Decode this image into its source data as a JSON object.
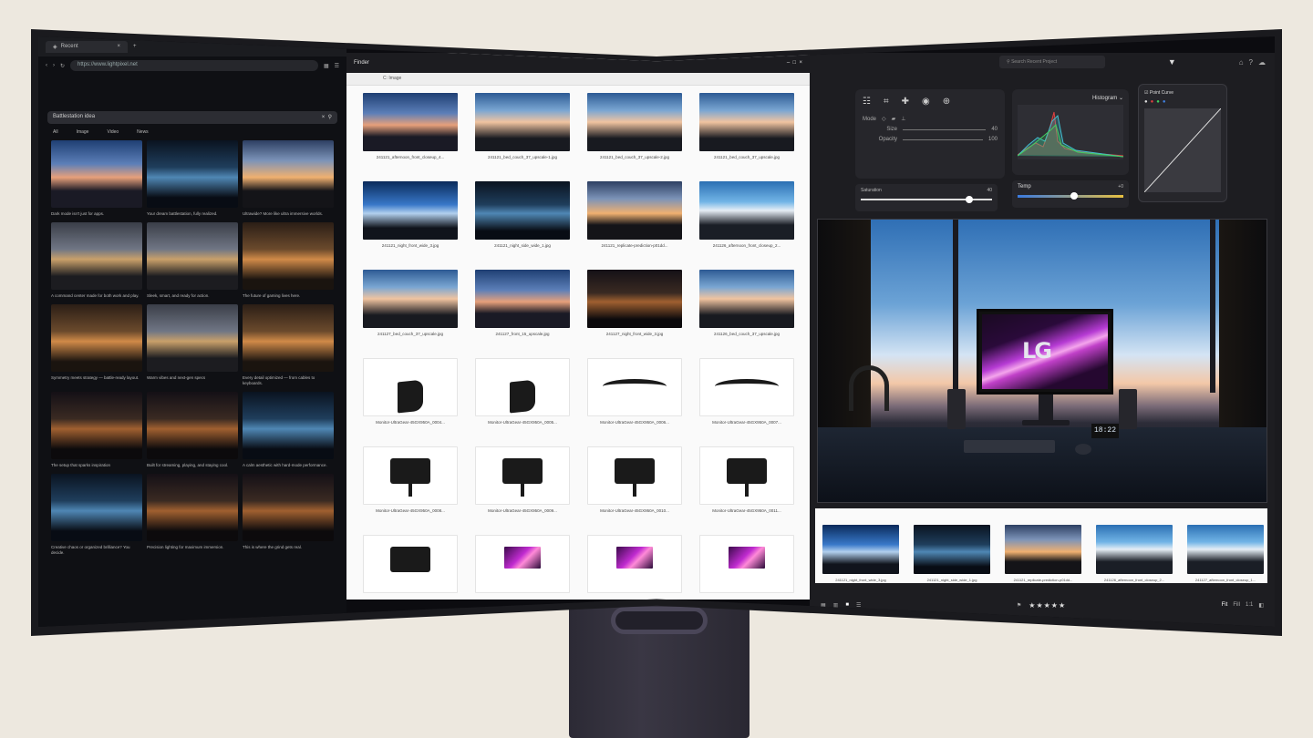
{
  "browser": {
    "tab_title": "Recent",
    "url": "https://www.lightpixel.net",
    "search_query": "Battlestation idea",
    "filters": [
      "All",
      "Image",
      "Video",
      "News"
    ],
    "results": [
      {
        "caption": "Dark mode isn't just for apps."
      },
      {
        "caption": "Your dream battlestation, fully realized."
      },
      {
        "caption": "Ultrawide? More like ultra immersive worlds."
      },
      {
        "caption": "A command center made for both work and play."
      },
      {
        "caption": "Sleek, smart, and ready for action."
      },
      {
        "caption": "The future of gaming lives here."
      },
      {
        "caption": "Symmetry meets strategy — battle-ready layout."
      },
      {
        "caption": "Warm vibes and next-gen specs"
      },
      {
        "caption": "Every detail optimized — from cables to keyboards."
      },
      {
        "caption": "The setup that sparks inspiration"
      },
      {
        "caption": "Built for streaming, playing, and staying cool."
      },
      {
        "caption": "A calm aesthetic with hard-mode performance."
      },
      {
        "caption": "Creative chaos or organized brilliance? You decide."
      },
      {
        "caption": "Precision lighting for maximum immersion."
      },
      {
        "caption": "This is where the grind gets real."
      }
    ]
  },
  "finder": {
    "title": "Finder",
    "path": "C: Image",
    "files": [
      "241121_afternoon_front_closeup_4...",
      "241121_bed_couch_37_upscale-1.jpg",
      "241121_bed_couch_37_upscale-2.jpg",
      "241121_bed_couch_37_upscale.jpg",
      "241121_night_front_wide_3.jpg",
      "241121_night_side_wide_1.jpg",
      "241121_replicate-prediction-p01dd...",
      "241126_afternoon_front_closeup_2...",
      "241127_bed_couch_37_upscale.jpg",
      "241127_front_15_upscale.jpg",
      "241127_night_front_wide_3.jpg",
      "241126_bed_couch_37_upscale.jpg",
      "Monitor-UltraGear-45GX950A_0004...",
      "Monitor-UltraGear-45GX950A_0005...",
      "Monitor-UltraGear-45GX950A_0006...",
      "Monitor-UltraGear-45GX950A_0007...",
      "Monitor-UltraGear-45GX950A_0008...",
      "Monitor-UltraGear-45GX950A_0009...",
      "Monitor-UltraGear-45GX950A_0010...",
      "Monitor-UltraGear-45GX950A_0011...",
      "",
      "",
      "",
      ""
    ]
  },
  "editor": {
    "search_placeholder": "Search Recent Project",
    "mode_label": "Mode",
    "size_label": "Size",
    "size_value": "40",
    "opacity_label": "Opacity",
    "opacity_value": "100",
    "histogram_label": "Histogram",
    "curve_label": "Point Curve",
    "saturation_label": "Saturation",
    "saturation_value": "40",
    "temp_label": "Temp",
    "temp_value": "+0",
    "clock_text": "18:22",
    "logo_text": "LG",
    "filmstrip": [
      "241121_night_front_wide_3.jpg",
      "241121_night_side_wide_1.jpg",
      "241121_replicate-prediction-p01dd...",
      "241126_afternoon_front_closeup_2...",
      "241127_afternoon_front_closeup_1..."
    ],
    "rating_stars": "★★★★★",
    "view_options": [
      "Fit",
      "Fill",
      "1:1"
    ]
  }
}
